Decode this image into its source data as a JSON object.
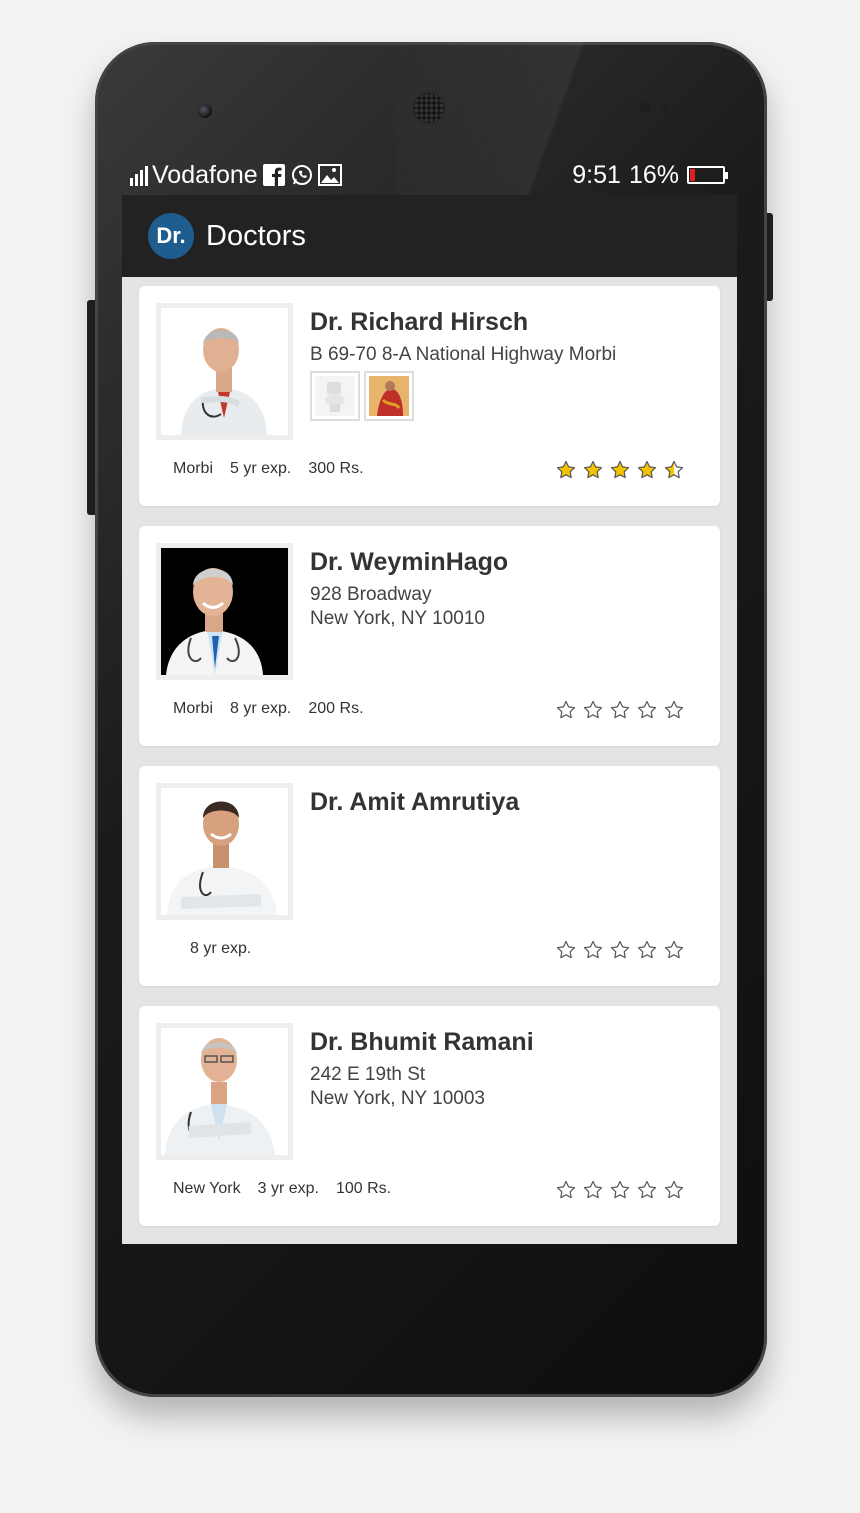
{
  "status": {
    "carrier": "Vodafone",
    "time": "9:51",
    "battery": "16%"
  },
  "app": {
    "logo_text": "Dr.",
    "title": "Doctors"
  },
  "doctors": [
    {
      "name": "Dr. Richard Hirsch",
      "address_line1": "B 69-70 8-A National Highway Morbi",
      "address_line2": "",
      "city": "Morbi",
      "experience": "5 yr exp.",
      "fee": "300 Rs.",
      "rating": 4.5
    },
    {
      "name": "Dr. WeyminHago",
      "address_line1": "928 Broadway",
      "address_line2": "New York, NY 10010",
      "city": "Morbi",
      "experience": "8 yr exp.",
      "fee": "200 Rs.",
      "rating": 0
    },
    {
      "name": "Dr. Amit Amrutiya",
      "address_line1": "",
      "address_line2": "",
      "city": "",
      "experience": "8 yr exp.",
      "fee": "",
      "rating": 0
    },
    {
      "name": "Dr. Bhumit Ramani",
      "address_line1": "242 E 19th St",
      "address_line2": "New York, NY 10003",
      "city": "New York",
      "experience": "3 yr exp.",
      "fee": "100 Rs.",
      "rating": 0
    }
  ],
  "colors": {
    "star_filled": "#f5c400",
    "logo_bg": "#1f5d8f",
    "battery_low": "#e02020"
  }
}
